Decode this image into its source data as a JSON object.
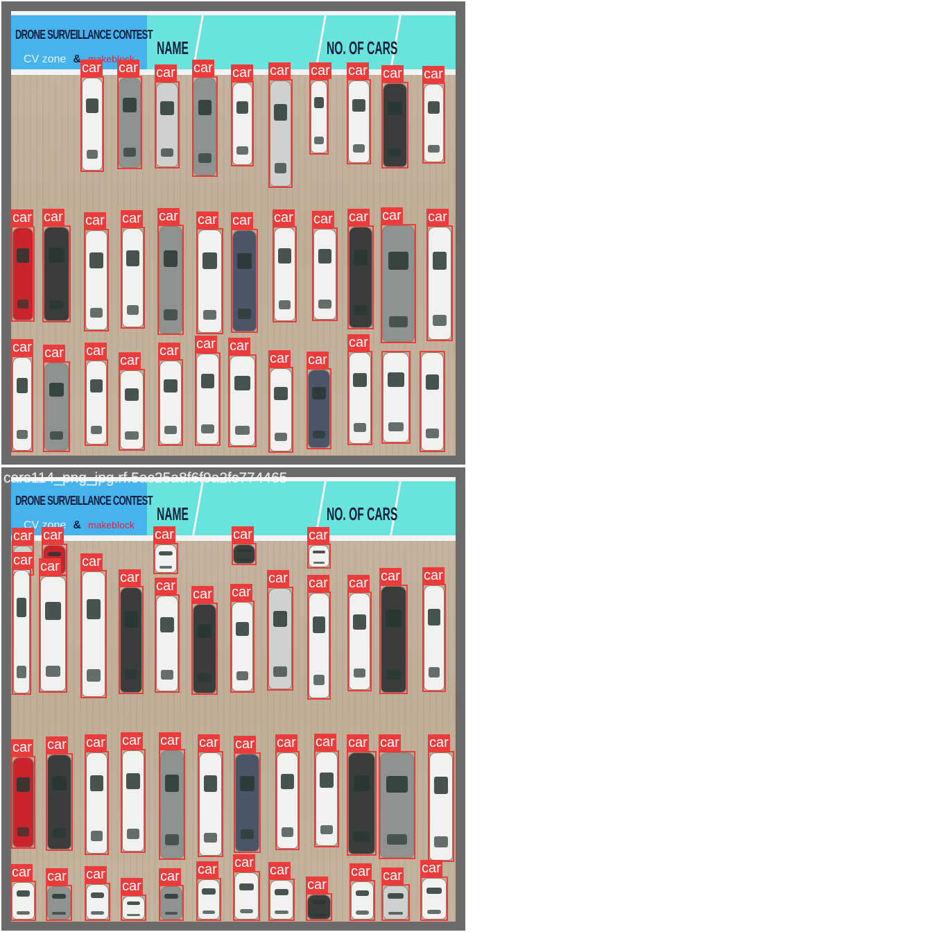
{
  "tiles": [
    {
      "banner": {
        "title": "DRONE SURVEILLANCE CONTEST",
        "sponsor_left": "CV zone",
        "ampersand": "&",
        "sponsor_right": "makeblock",
        "name_header": "NAME",
        "cars_header": "NO. OF CARS"
      },
      "detection_label": "car"
    },
    {
      "banner": {
        "title": "DRONE SURVEILLANCE CONTEST",
        "sponsor_left": "CV zone",
        "ampersand": "&",
        "sponsor_right": "makeblock",
        "name_header": "NAME",
        "cars_header": "NO. OF CARS"
      },
      "caption": "cars114_png_jpg.rf.5ac25a8f6f9a2fc774465",
      "detection_label": "car"
    }
  ],
  "colors": {
    "box": "#ec3b3b",
    "banner_cyan": "#68e4dc",
    "banner_blue": "#47b3ec"
  }
}
